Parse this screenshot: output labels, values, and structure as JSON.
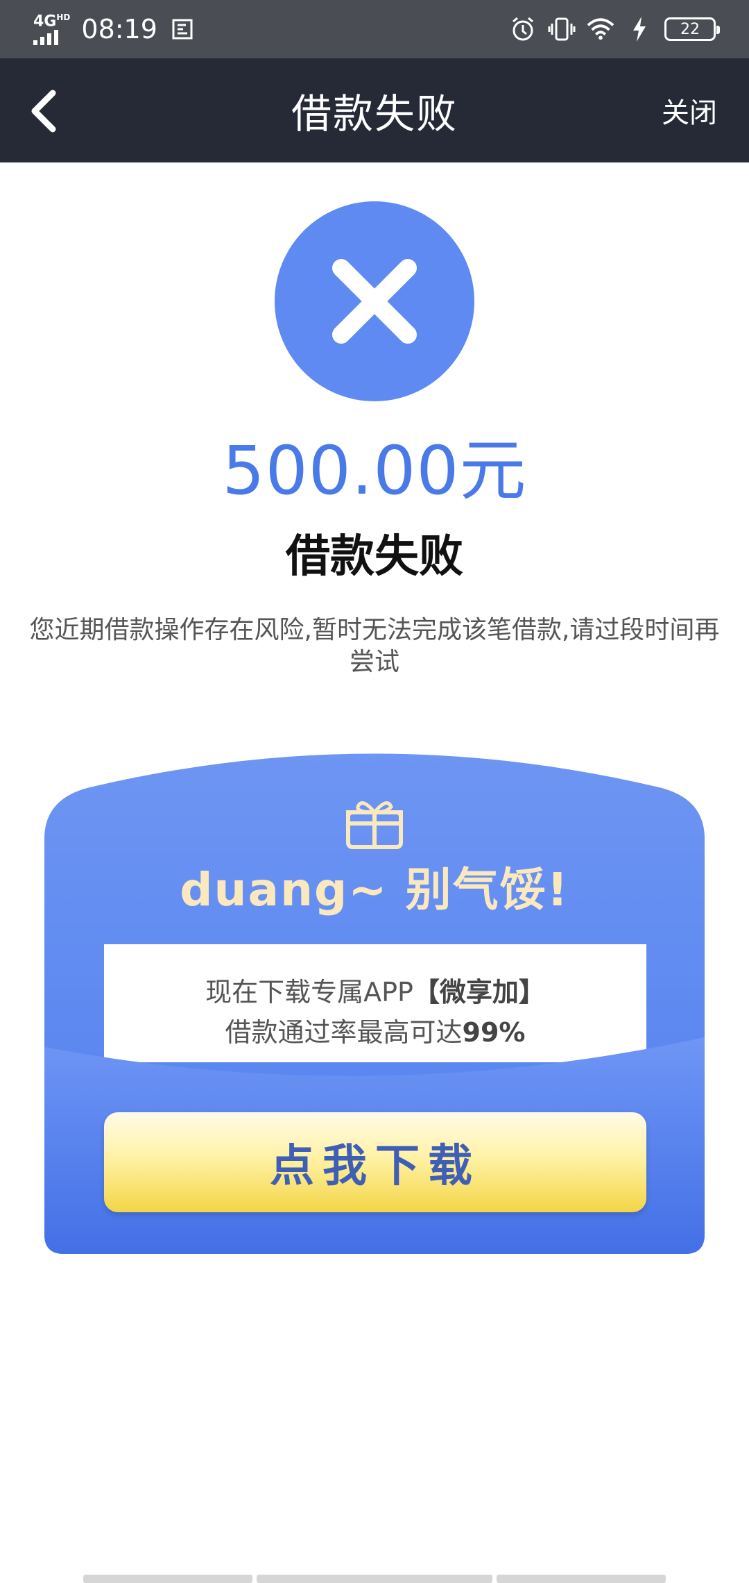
{
  "status_bar": {
    "network": "4G",
    "network_hd": "HD",
    "time": "08:19",
    "battery": "22",
    "icons": [
      "signal-icon",
      "screenshot-icon",
      "alarm-icon",
      "vibrate-icon",
      "wifi-icon",
      "charging-icon",
      "battery-icon"
    ]
  },
  "nav": {
    "title": "借款失败",
    "close_label": "关闭",
    "back_icon": "back-arrow-icon"
  },
  "result": {
    "icon": "close-icon",
    "amount": "500.00元",
    "status": "借款失败",
    "message": "您近期借款操作存在风险,暂时无法完成该笔借款,请过段时间再尝试"
  },
  "promo": {
    "icon": "gift-icon",
    "title": "duang~ 别气馁!",
    "line1_prefix": "现在下载专属APP",
    "line1_app": "【微享加】",
    "line2_prefix": "借款通过率最高可达",
    "line2_rate": "99%",
    "button_label": "点我下载"
  },
  "colors": {
    "status_bar_bg": "#4a4d53",
    "nav_bg": "#252a36",
    "accent_blue": "#5f8af2",
    "amount_blue": "#4a7ae8",
    "promo_title": "#fbe9bd",
    "button_text": "#3f5fb6",
    "button_yellow": "#f3d545"
  }
}
